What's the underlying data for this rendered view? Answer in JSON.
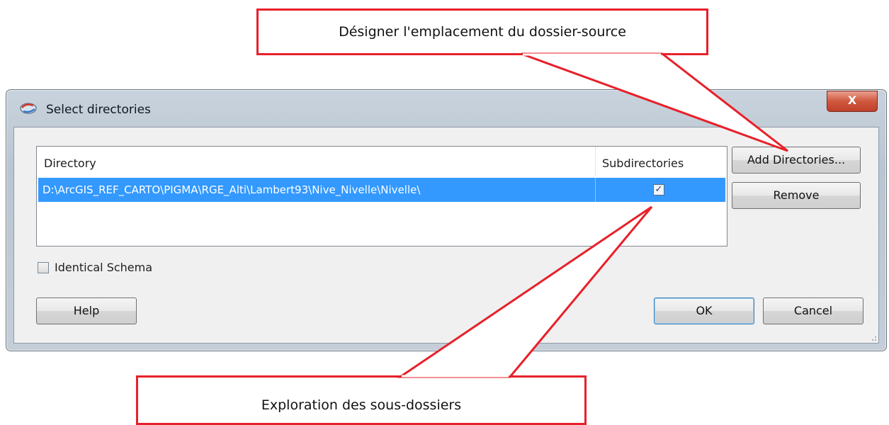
{
  "callouts": {
    "top": "Désigner l'emplacement du dossier-source",
    "bottom": "Exploration des sous-dossiers"
  },
  "dialog": {
    "title": "Select directories",
    "close_label": "X",
    "columns": {
      "directory": "Directory",
      "subdirectories": "Subdirectories"
    },
    "rows": [
      {
        "path": "D:\\ArcGIS_REF_CARTO\\PIGMA\\RGE_Alti\\Lambert93\\Nive_Nivelle\\Nivelle\\",
        "subdirectories_checked": true,
        "selected": true
      }
    ],
    "identical_schema_label": "Identical Schema",
    "identical_schema_checked": false,
    "buttons": {
      "add_directories": "Add Directories...",
      "remove": "Remove",
      "help": "Help",
      "ok": "OK",
      "cancel": "Cancel"
    }
  },
  "colors": {
    "callout_border": "#e8202a",
    "selection": "#3399ff"
  }
}
